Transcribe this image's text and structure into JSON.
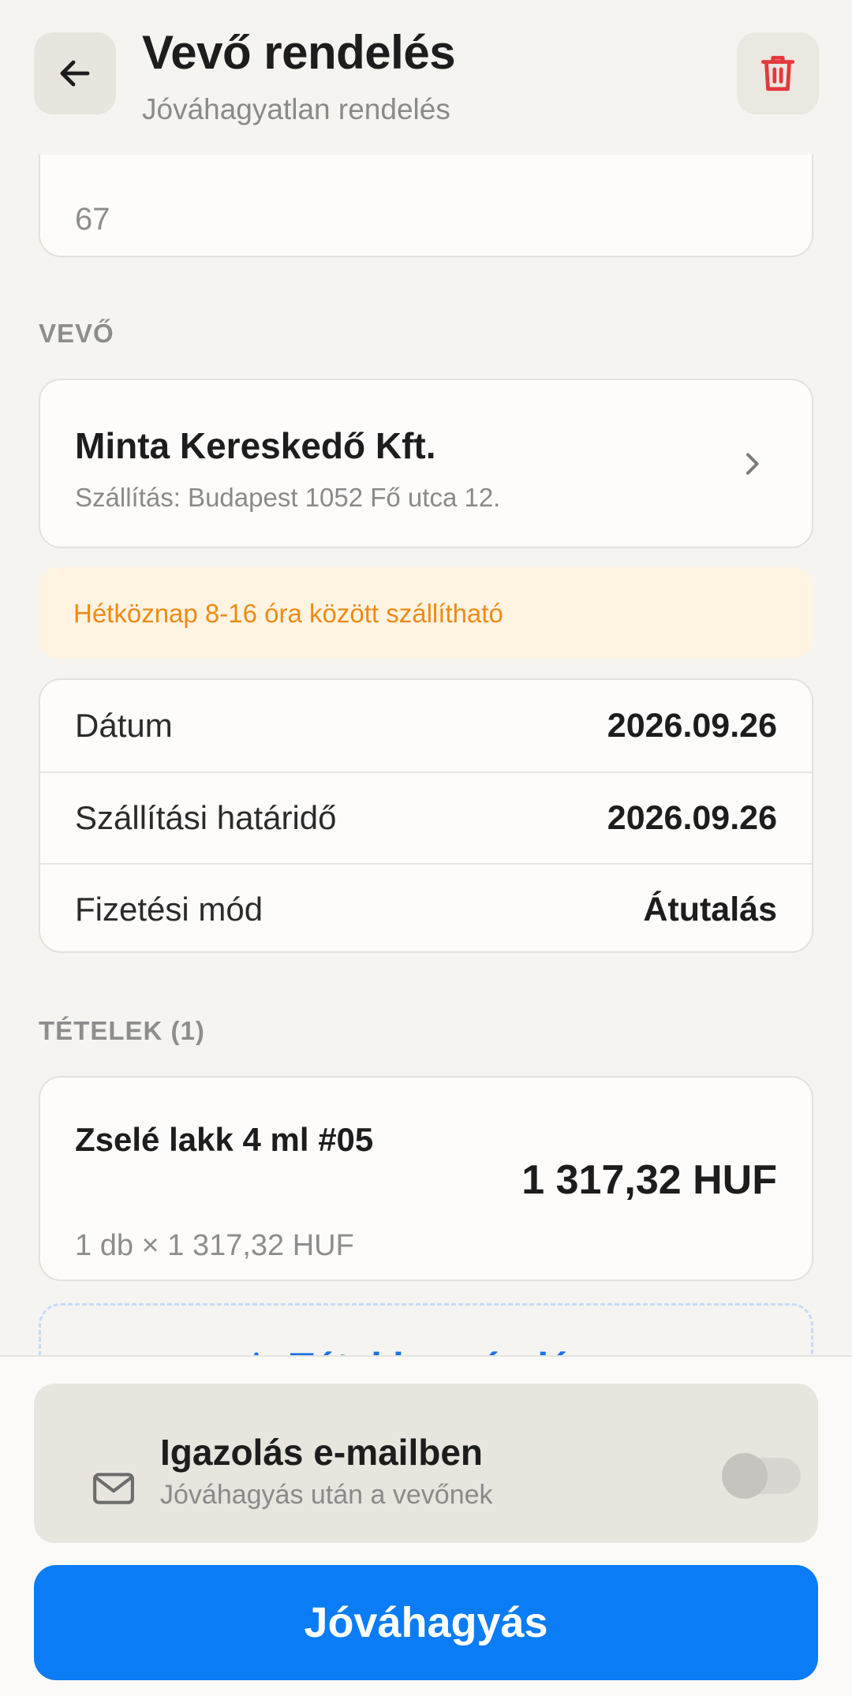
{
  "header": {
    "title": "Vevő rendelés",
    "subtitle": "Jóváhagyatlan rendelés",
    "back_icon": "arrow-left-icon",
    "delete_icon": "trash-icon",
    "delete_color": "#e5383b"
  },
  "top_field": {
    "value": "67"
  },
  "buyer": {
    "section_label": "VEVŐ",
    "name": "Minta Kereskedő Kft.",
    "address": "Szállítás: Budapest 1052 Fő utca 12."
  },
  "note": {
    "text": "Hétköznap 8-16 óra között szállítható",
    "color": "#ef8b13"
  },
  "details": [
    {
      "label": "Dátum",
      "value": "2026.09.26"
    },
    {
      "label": "Szállítási határidő",
      "value": "2026.09.26"
    },
    {
      "label": "Fizetési mód",
      "value": "Átutalás"
    }
  ],
  "items": {
    "section_label": "TÉTELEK (1)",
    "list": [
      {
        "name": "Zselé lakk 4 ml #05",
        "qty_line": "1 db × 1 317,32 HUF",
        "total": "1 317,32 HUF"
      }
    ],
    "add_label": "Tétel hozzáadása"
  },
  "email": {
    "title": "Igazolás e-mailben",
    "subtitle": "Jóváhagyás után a vevőnek",
    "toggle_on": false
  },
  "approve_label": "Jóváhagyás",
  "accent_color": "#0a7cf6"
}
